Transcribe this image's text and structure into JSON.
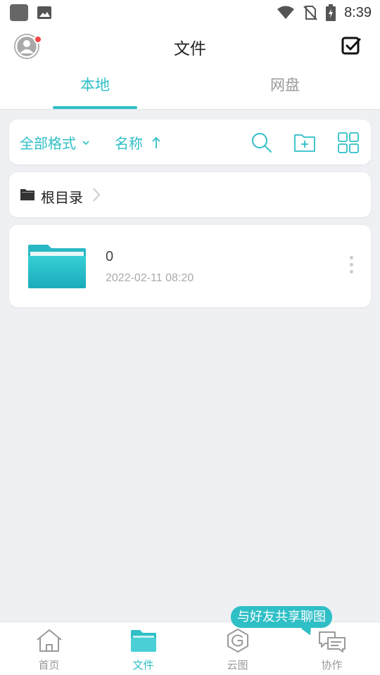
{
  "status_bar": {
    "time": "8:39",
    "icons": [
      "app-icon",
      "image-icon",
      "wifi-icon",
      "no-sim-icon",
      "battery-charging-icon"
    ]
  },
  "header": {
    "title": "文件",
    "avatar_icon": "user-avatar-icon",
    "select_icon": "checkbox-select-icon",
    "notification_color": "#f04848"
  },
  "tabs": [
    {
      "label": "本地",
      "active": true
    },
    {
      "label": "网盘",
      "active": false
    }
  ],
  "toolbar": {
    "format_filter_label": "全部格式",
    "sort_label": "名称",
    "sort_direction_icon": "arrow-up-icon",
    "action_icons": [
      "search-icon",
      "new-folder-icon",
      "grid-view-icon"
    ]
  },
  "breadcrumb": {
    "root_label": "根目录"
  },
  "files": [
    {
      "name": "0",
      "date": "2022-02-11 08:20",
      "type": "folder"
    }
  ],
  "bottom_nav": [
    {
      "label": "首页",
      "icon": "home-icon",
      "active": false
    },
    {
      "label": "文件",
      "icon": "folder-icon",
      "active": true
    },
    {
      "label": "云图",
      "icon": "cloud-gallery-icon",
      "active": false
    },
    {
      "label": "协作",
      "icon": "chat-bubbles-icon",
      "active": false
    }
  ],
  "tooltip": {
    "text": "与好友共享聊图"
  },
  "colors": {
    "accent": "#2fbfc6",
    "background": "#eef0f3",
    "inactive_text": "#999999"
  }
}
